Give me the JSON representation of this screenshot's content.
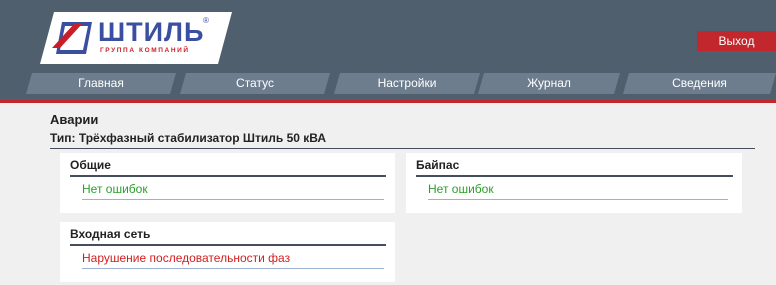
{
  "brand": {
    "name": "ШТИЛЬ",
    "tagline": "ГРУППА КОМПАНИЙ",
    "registered_mark": "®",
    "colors": {
      "blue": "#3a4fa0",
      "red": "#c81e28"
    }
  },
  "header": {
    "exit_label": "Выход",
    "background": "#4f5f6e",
    "accent": "#c1272d"
  },
  "nav": {
    "tabs": [
      {
        "label": "Главная"
      },
      {
        "label": "Статус"
      },
      {
        "label": "Настройки"
      },
      {
        "label": "Журнал"
      },
      {
        "label": "Сведения"
      }
    ]
  },
  "page": {
    "title": "Аварии",
    "device_type": "Тип: Трёхфазный стабилизатор Штиль 50 кВА"
  },
  "panels": [
    {
      "title": "Общие",
      "message": "Нет ошибок",
      "status": "ok",
      "color": "#2aa02a"
    },
    {
      "title": "Байпас",
      "message": "Нет ошибок",
      "status": "ok",
      "color": "#2aa02a"
    },
    {
      "title": "Входная сеть",
      "message": "Нарушение последовательности фаз",
      "status": "error",
      "color": "#d0201f"
    }
  ]
}
